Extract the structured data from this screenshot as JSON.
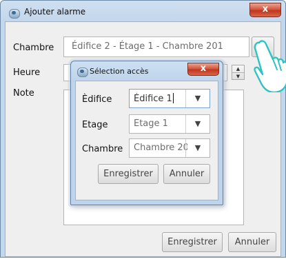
{
  "window": {
    "title": "Ajouter alarme",
    "close_label": "x",
    "accent_color": "#c6d9ee",
    "close_color": "#c9452d",
    "form": {
      "chambre_label": "Chambre",
      "chambre_value": "Édifice 2 - Étage 1 - Chambre 201",
      "browse_label": "...",
      "heure_label": "Heure",
      "note_label": "Note",
      "spinner_up": "▲",
      "spinner_down": "▼"
    },
    "buttons": {
      "save_label": "Enregistrer",
      "cancel_label": "Annuler"
    }
  },
  "dialog": {
    "title": "Sélection accès",
    "close_label": "x",
    "fields": {
      "edifice_label": "Èdifice",
      "edifice_value": "Édifice 1",
      "etage_label": "Etage",
      "etage_value": "Étage 1",
      "chambre_label": "Chambre",
      "chambre_value": "Chambre 20",
      "dropdown_arrow": "▼"
    },
    "buttons": {
      "save_label": "Enregistrer",
      "cancel_label": "Annuler"
    }
  },
  "icons": {
    "app_icon": "bird-logo-icon",
    "cursor": "hand-pointer-icon"
  }
}
